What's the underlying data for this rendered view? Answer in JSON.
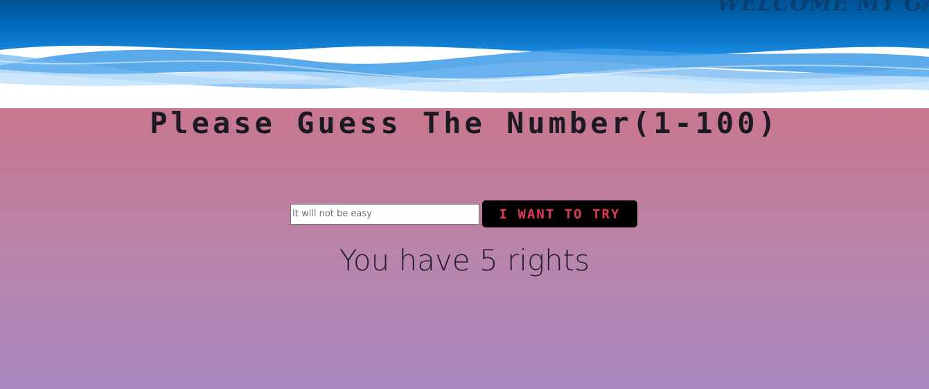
{
  "header": {
    "welcome_text": "WELCOME MY GA"
  },
  "game": {
    "title": "Please Guess The Number(1-100)",
    "input": {
      "value": "",
      "placeholder": "It will not be easy"
    },
    "submit_label": "I WANT TO TRY",
    "status_text": "You have 5 rights"
  },
  "colors": {
    "banner_blue": "#0060b0",
    "button_text": "#e23a55",
    "button_bg": "#000000",
    "title_text": "#1b1a22"
  }
}
